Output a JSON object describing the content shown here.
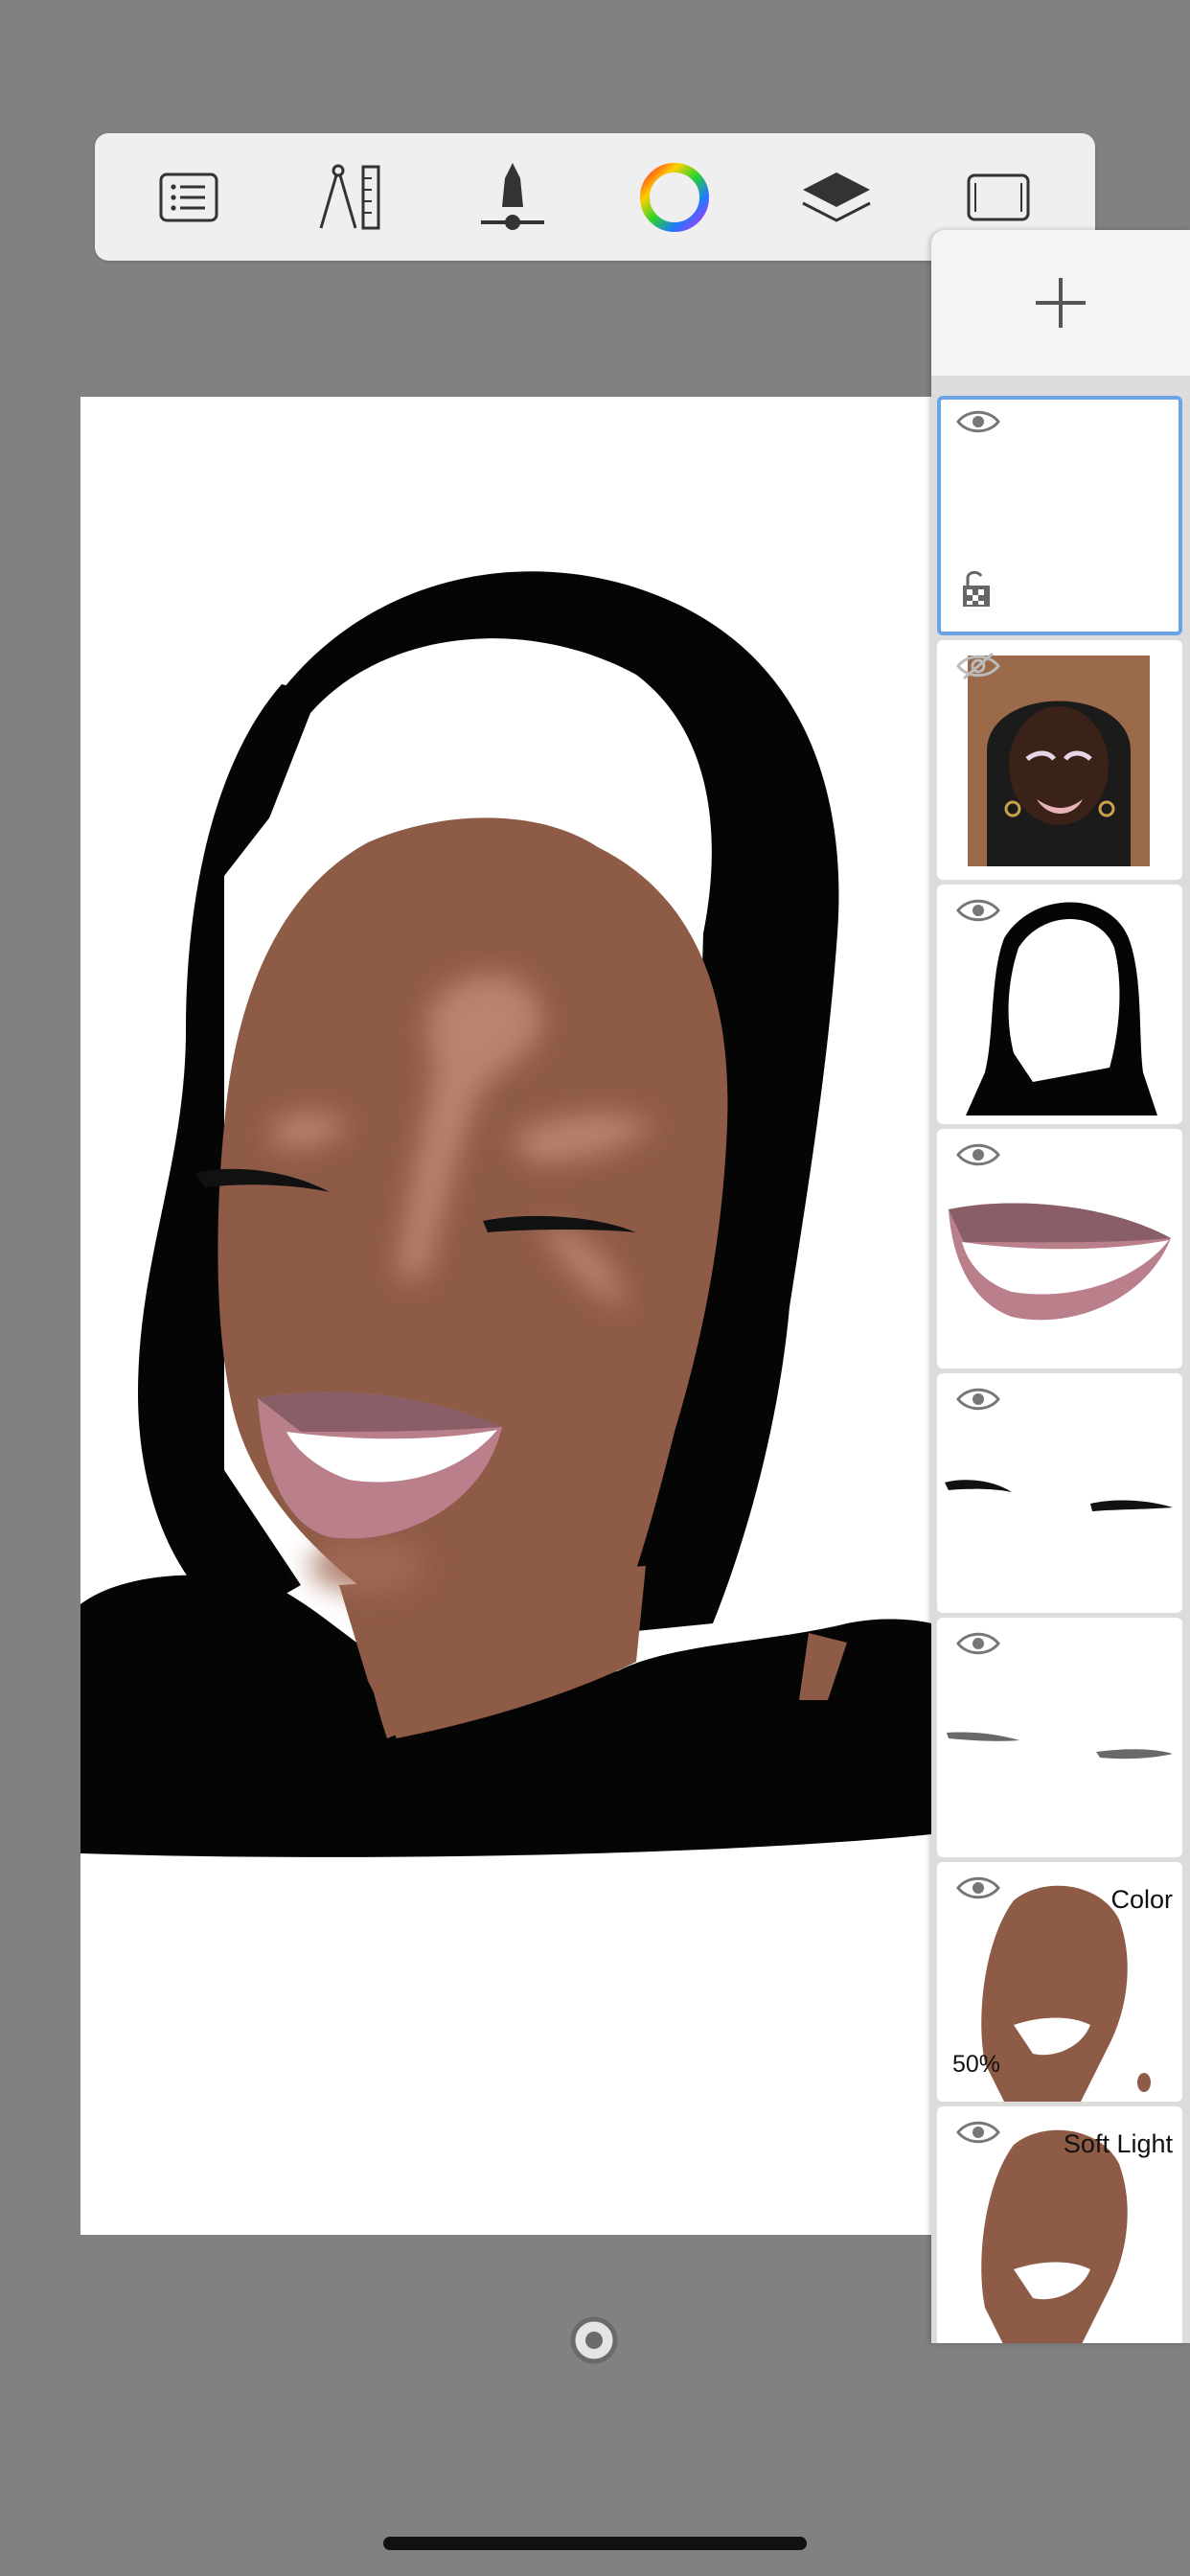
{
  "toolbar": {
    "tools": [
      {
        "icon": "menu-list-icon"
      },
      {
        "icon": "compass-ruler-icon"
      },
      {
        "icon": "brush-size-icon"
      },
      {
        "icon": "color-wheel-icon"
      },
      {
        "icon": "layers-icon"
      },
      {
        "icon": "fullscreen-icon"
      }
    ]
  },
  "layers_panel": {
    "add_icon": "plus-icon",
    "layers": [
      {
        "name": "highlight-layer",
        "visible": true,
        "selected": true,
        "locked_alpha": true
      },
      {
        "name": "reference-photo-layer",
        "visible": false
      },
      {
        "name": "hair-silhouette-layer",
        "visible": true
      },
      {
        "name": "lips-layer",
        "visible": true
      },
      {
        "name": "eyelashes-layer",
        "visible": true
      },
      {
        "name": "eyebrows-layer",
        "visible": true
      },
      {
        "name": "skin-color-layer",
        "visible": true,
        "blend": "Color",
        "opacity": "50%"
      },
      {
        "name": "skin-softlight-layer",
        "visible": true,
        "blend": "Soft Light"
      }
    ]
  },
  "colors": {
    "background": "#818181",
    "toolbar": "#efefef",
    "skin": "#8e5b47",
    "lips": "#b97f8a",
    "lip_upper": "#8a5e66",
    "hair": "#050505",
    "selection": "#6aa3e8"
  }
}
